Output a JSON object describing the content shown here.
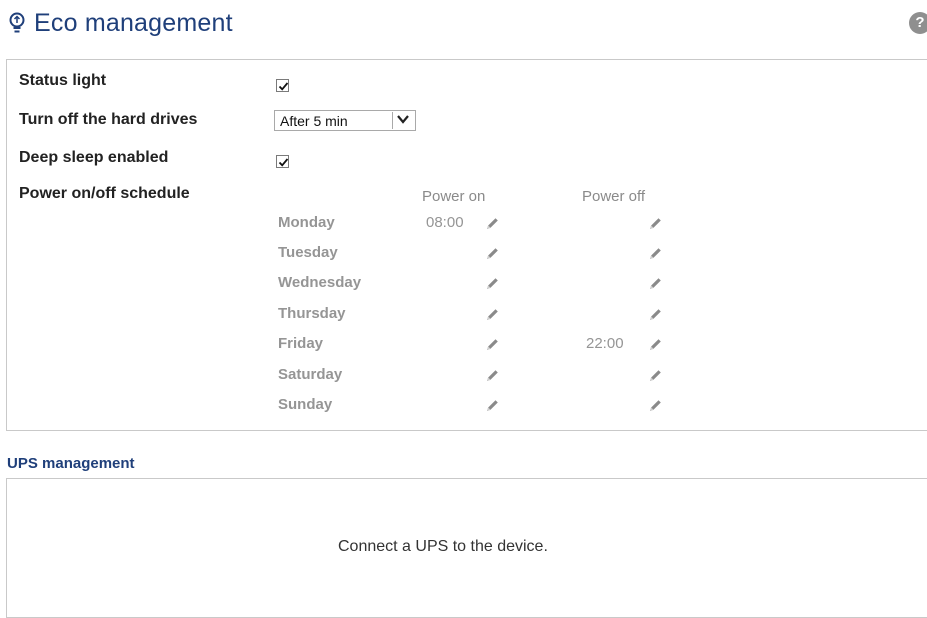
{
  "header": {
    "title": "Eco management",
    "icon": "lightbulb-icon",
    "help_icon": "help-icon",
    "help_glyph": "?",
    "title_color": "#1f3f7a"
  },
  "settings": {
    "status_light": {
      "label": "Status light",
      "checked": true
    },
    "hard_drives": {
      "label": "Turn off the hard drives",
      "selected": "After 5 min"
    },
    "deep_sleep": {
      "label": "Deep sleep enabled",
      "checked": true
    },
    "schedule": {
      "label": "Power on/off schedule",
      "col_power_on": "Power on",
      "col_power_off": "Power off",
      "days": [
        {
          "name": "Monday",
          "power_on": "08:00",
          "power_off": ""
        },
        {
          "name": "Tuesday",
          "power_on": "",
          "power_off": ""
        },
        {
          "name": "Wednesday",
          "power_on": "",
          "power_off": ""
        },
        {
          "name": "Thursday",
          "power_on": "",
          "power_off": ""
        },
        {
          "name": "Friday",
          "power_on": "",
          "power_off": "22:00"
        },
        {
          "name": "Saturday",
          "power_on": "",
          "power_off": ""
        },
        {
          "name": "Sunday",
          "power_on": "",
          "power_off": ""
        }
      ]
    }
  },
  "ups": {
    "title": "UPS management",
    "message": "Connect a UPS to the device."
  }
}
